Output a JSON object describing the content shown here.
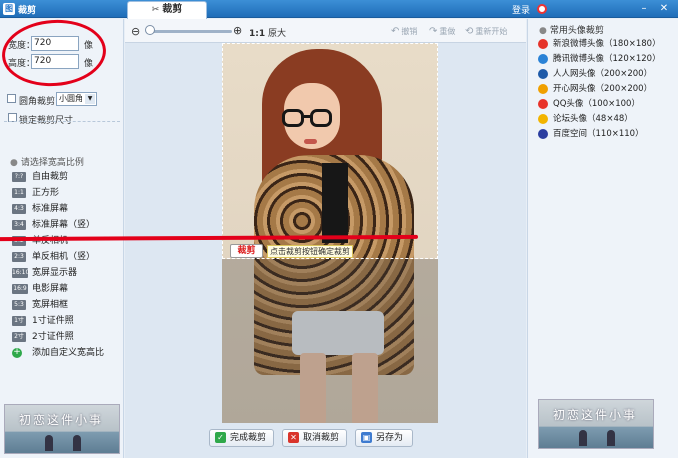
{
  "titlebar": {
    "app_title": "裁剪",
    "tab_label": "裁剪",
    "tab_icon": "scissors-icon",
    "login": "登录",
    "minimize_glyph": "–",
    "close_glyph": "✕"
  },
  "size": {
    "width_label": "宽度：",
    "width_value": "720",
    "width_unit": "像",
    "height_label": "高度：",
    "height_value": "720",
    "height_unit": "像",
    "rounded_label": "圆角裁剪",
    "rounded_select": "小圆角",
    "lock_label": "锁定裁剪尺寸"
  },
  "ratio": {
    "heading": "请选择宽高比例",
    "items": [
      {
        "badge": "?:?",
        "label": "自由裁剪"
      },
      {
        "badge": "1:1",
        "label": "正方形"
      },
      {
        "badge": "4:3",
        "label": "标准屏幕"
      },
      {
        "badge": "3:4",
        "label": "标准屏幕（竖）"
      },
      {
        "badge": "3:2",
        "label": "单反相机"
      },
      {
        "badge": "2:3",
        "label": "单反相机（竖）"
      },
      {
        "badge": "16:10",
        "label": "宽屏显示器"
      },
      {
        "badge": "16:9",
        "label": "电影屏幕"
      },
      {
        "badge": "5:3",
        "label": "宽屏相框"
      },
      {
        "badge": "1寸",
        "label": "1寸证件照"
      },
      {
        "badge": "2寸",
        "label": "2寸证件照"
      },
      {
        "badge": "+",
        "label": "添加自定义宽高比"
      }
    ]
  },
  "thumb": {
    "text": "初恋这件小事"
  },
  "toolbar": {
    "actual_ratio": "1:1",
    "actual_label": "原大",
    "undo": "撤销",
    "redo": "重做",
    "restart": "重新开始"
  },
  "canvas": {
    "crop_button": "裁剪",
    "crop_tip": "点击裁剪按钮确定裁剪"
  },
  "actions": {
    "finish": "完成裁剪",
    "cancel": "取消裁剪",
    "save_as": "另存为"
  },
  "avatars": {
    "heading": "常用头像裁剪",
    "items": [
      {
        "label": "新浪微博头像（180×180）",
        "icon": "weibo-icon",
        "color": "#e5332a"
      },
      {
        "label": "腾讯微博头像（120×120）",
        "icon": "tencent-weibo-icon",
        "color": "#2a82d6"
      },
      {
        "label": "人人网头像（200×200）",
        "icon": "renren-icon",
        "color": "#1e5aa8"
      },
      {
        "label": "开心网头像（200×200）",
        "icon": "kaixin-icon",
        "color": "#f0a000"
      },
      {
        "label": "QQ头像（100×100）",
        "icon": "qq-icon",
        "color": "#e8332a"
      },
      {
        "label": "论坛头像（48×48）",
        "icon": "forum-icon",
        "color": "#f2b400"
      },
      {
        "label": "百度空间（110×110）",
        "icon": "baidu-icon",
        "color": "#2b3ea0"
      }
    ]
  },
  "colors": {
    "titlebar": "#1f6db8",
    "annotation_red": "#e3001a",
    "crop_button_text": "#dd2222"
  }
}
